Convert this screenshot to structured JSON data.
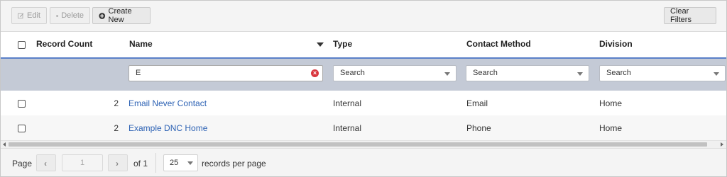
{
  "toolbar": {
    "edit_label": "Edit",
    "delete_label": "Delete",
    "create_label": "Create New",
    "clear_filters_label": "Clear Filters"
  },
  "table": {
    "columns": [
      "Record Count",
      "Name",
      "Type",
      "Contact Method",
      "Division"
    ],
    "filters": {
      "name_value": "E",
      "type_placeholder": "Search",
      "contact_placeholder": "Search",
      "division_placeholder": "Search"
    },
    "rows": [
      {
        "record_count": "2",
        "name": "Email Never Contact",
        "type": "Internal",
        "contact_method": "Email",
        "division": "Home"
      },
      {
        "record_count": "2",
        "name": "Example DNC Home",
        "type": "Internal",
        "contact_method": "Phone",
        "division": "Home"
      }
    ]
  },
  "pager": {
    "page_label": "Page",
    "page_value": "1",
    "of_label": "of 1",
    "page_size": "25",
    "records_label": "records per page"
  },
  "colors": {
    "link": "#2d62b4",
    "header_underline": "#5a7fc8",
    "filter_row_bg": "#c4cad6",
    "clear_icon": "#d9363e"
  }
}
